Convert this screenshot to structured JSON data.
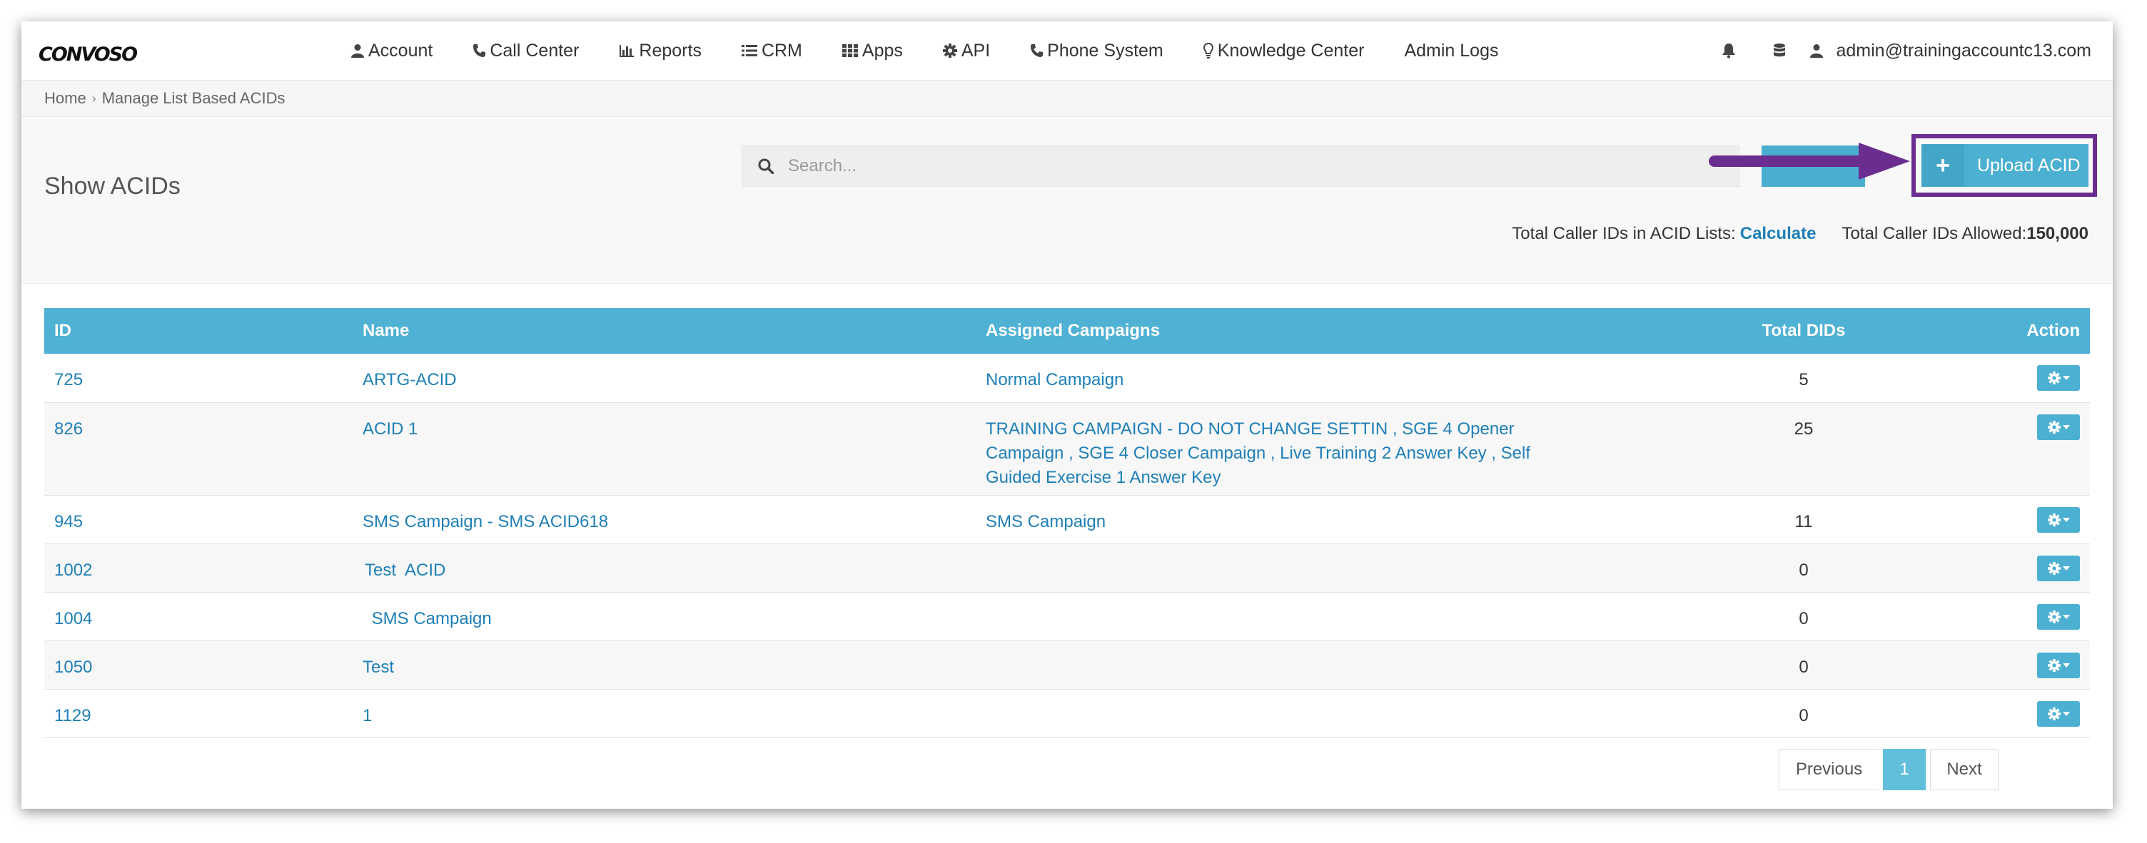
{
  "app": {
    "logo_text": "CONVOSO"
  },
  "nav": {
    "items": [
      {
        "label": "Account",
        "icon": "user-icon"
      },
      {
        "label": "Call Center",
        "icon": "phone-icon"
      },
      {
        "label": "Reports",
        "icon": "bar-chart-icon"
      },
      {
        "label": "CRM",
        "icon": "list-icon"
      },
      {
        "label": "Apps",
        "icon": "grid-icon"
      },
      {
        "label": "API",
        "icon": "gear-icon"
      },
      {
        "label": "Phone System",
        "icon": "phone-icon"
      },
      {
        "label": "Knowledge Center",
        "icon": "lightbulb-icon"
      },
      {
        "label": "Admin Logs",
        "icon": ""
      }
    ],
    "user_email": "admin@trainingaccountc13.com"
  },
  "breadcrumb": {
    "home": "Home",
    "current": "Manage List Based ACIDs"
  },
  "header": {
    "title": "Show ACIDs",
    "search_placeholder": "Search...",
    "upload_label": "Upload ACID",
    "upload_icon_text": "+",
    "totals_label": "Total Caller IDs in ACID Lists:",
    "calculate_label": "Calculate",
    "allowed_label": "Total Caller IDs Allowed:",
    "allowed_value": "150,000"
  },
  "table": {
    "columns": [
      "ID",
      "Name",
      "Assigned Campaigns",
      "Total DIDs",
      "Action"
    ],
    "rows": [
      {
        "id": "725",
        "name": "ARTG-ACID",
        "campaigns": "Normal Campaign",
        "dids": "5"
      },
      {
        "id": "826",
        "name": "ACID 1",
        "campaigns": "TRAINING CAMPAIGN - DO NOT CHANGE SETTIN , SGE 4 Opener Campaign , SGE 4 Closer Campaign , Live Training 2 Answer Key , Self Guided Exercise 1 Answer Key",
        "dids": "25"
      },
      {
        "id": "945",
        "name": "SMS Campaign - SMS ACID618",
        "campaigns": "SMS Campaign",
        "dids": "11"
      },
      {
        "id": "1002",
        "name": "Test  ACID",
        "campaigns": "",
        "dids": "0"
      },
      {
        "id": "1004",
        "name": " SMS Campaign",
        "campaigns": "",
        "dids": "0"
      },
      {
        "id": "1050",
        "name": "Test",
        "campaigns": "",
        "dids": "0"
      },
      {
        "id": "1129",
        "name": "1",
        "campaigns": "",
        "dids": "0"
      }
    ]
  },
  "pagination": {
    "previous": "Previous",
    "current": "1",
    "next": "Next"
  },
  "colors": {
    "accent": "#4fb1d3",
    "link": "#1e7fb8",
    "highlight": "#6b2d8f"
  }
}
